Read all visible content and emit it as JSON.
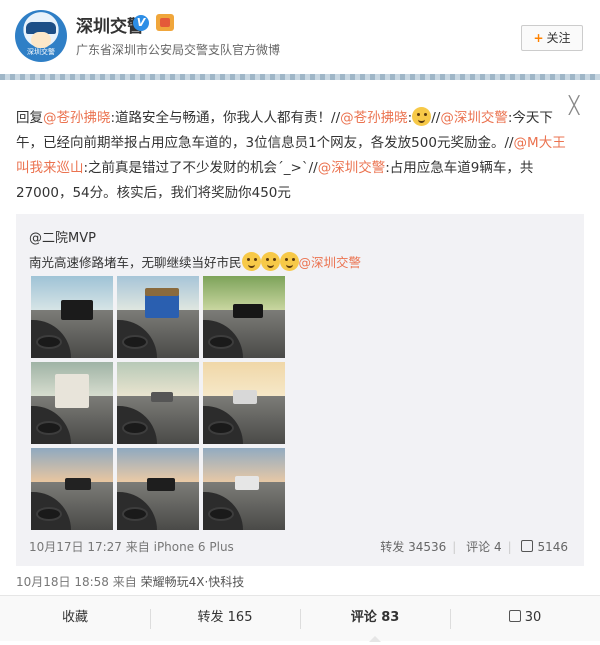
{
  "author": {
    "name": "深圳交警",
    "verified_mark": "V",
    "description": "广东省深圳市公安局交警支队官方微博",
    "avatar_caption": "深圳交警",
    "follow_label": "关注",
    "follow_icon": "+"
  },
  "close_icon": "╳",
  "content": {
    "reply_prefix": "回复",
    "mention_1": "@苍孙拂晓",
    "text_1": ":道路安全与畅通，你我人人都有责！//",
    "mention_2": "@苍孙拂晓",
    "text_2": ":",
    "text_3": "//",
    "mention_3": "@深圳交警",
    "text_4": ":今天下午，已经向前期举报占用应急车道的，3位信息员1个网友，各发放500元奖励金。//",
    "mention_4": "@M大王叫我来巡山",
    "text_5": ":之前真是错过了不少发财的机会´_>`//",
    "mention_5": "@深圳交警",
    "text_6": ":占用应急车道9辆车，共27000，54分。核实后，我们将奖励你450元"
  },
  "repost": {
    "user": "@二院MVP",
    "text": "南光高速修路堵车，无聊继续当好市民",
    "mention": "@深圳交警",
    "time": "10月17日 17:27",
    "source_prefix": "来自",
    "source": "iPhone 6 Plus",
    "repost_label": "转发 34536",
    "comment_label": "评论 4",
    "like_count": "5146"
  },
  "meta": {
    "time": "10月18日 18:58",
    "source_prefix": "来自",
    "source": "荣耀畅玩4X·快科技"
  },
  "actions": {
    "favorite": "收藏",
    "repost": "转发 165",
    "comment": "评论 83",
    "like": "30"
  },
  "colors": {
    "mention": "#eb7350",
    "follow_plus": "#ff8200",
    "verified": "#2d8ee6"
  }
}
